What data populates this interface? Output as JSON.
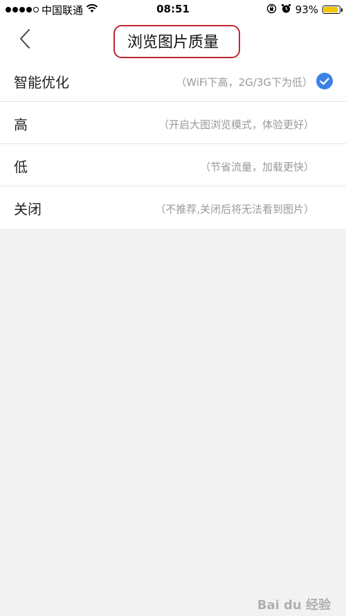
{
  "status_bar": {
    "carrier": "中国联通",
    "time": "08:51",
    "battery_percent": "93%",
    "battery_level": 0.93,
    "icons": [
      "signal-dots-icon",
      "wifi-icon",
      "orientation-lock-icon",
      "alarm-icon",
      "battery-icon"
    ]
  },
  "nav": {
    "title": "浏览图片质量",
    "back_icon": "chevron-left-icon"
  },
  "options": [
    {
      "label": "智能优化",
      "desc": "（WiFi下高，2G/3G下为低）",
      "selected": true
    },
    {
      "label": "高",
      "desc": "（开启大图浏览模式，体验更好）",
      "selected": false
    },
    {
      "label": "低",
      "desc": "（节省流量，加载更快）",
      "selected": false
    },
    {
      "label": "关闭",
      "desc": "（不推荐,关闭后将无法看到图片）",
      "selected": false
    }
  ],
  "watermark": "Bai du 经验",
  "colors": {
    "accent_check": "#3b82e6",
    "highlight_ring": "#c0272d",
    "battery_fill": "#f2c500",
    "background": "#f2f2f2"
  }
}
